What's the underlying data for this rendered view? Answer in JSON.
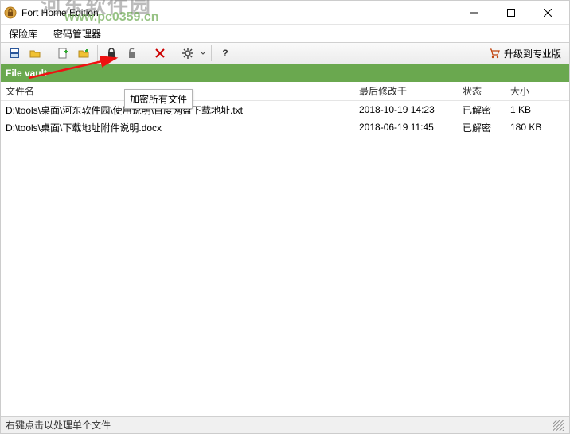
{
  "title": "Fort Home Edition",
  "menu": {
    "vault": "保险库",
    "pwmgr": "密码管理器"
  },
  "watermark": {
    "text": "河东软件园",
    "url": "www.pc0359.cn"
  },
  "toolbar": {
    "save": "save",
    "open": "open",
    "add_file": "add_file",
    "add_folder": "add_folder",
    "lock": "lock",
    "unlock": "unlock",
    "remove": "remove",
    "settings": "settings",
    "help": "?"
  },
  "upgrade_label": "升级到专业版",
  "tooltip": "加密所有文件",
  "section": "File vault",
  "columns": {
    "name": "文件名",
    "date": "最后修改于",
    "status": "状态",
    "size": "大小"
  },
  "rows": [
    {
      "name": "D:\\tools\\桌面\\河东软件园\\使用说明\\百度网盘下载地址.txt",
      "date": "2018-10-19 14:23",
      "status": "已解密",
      "size": "1 KB"
    },
    {
      "name": "D:\\tools\\桌面\\下载地址附件说明.docx",
      "date": "2018-06-19 11:45",
      "status": "已解密",
      "size": "180 KB"
    }
  ],
  "status": "右键点击以处理单个文件"
}
